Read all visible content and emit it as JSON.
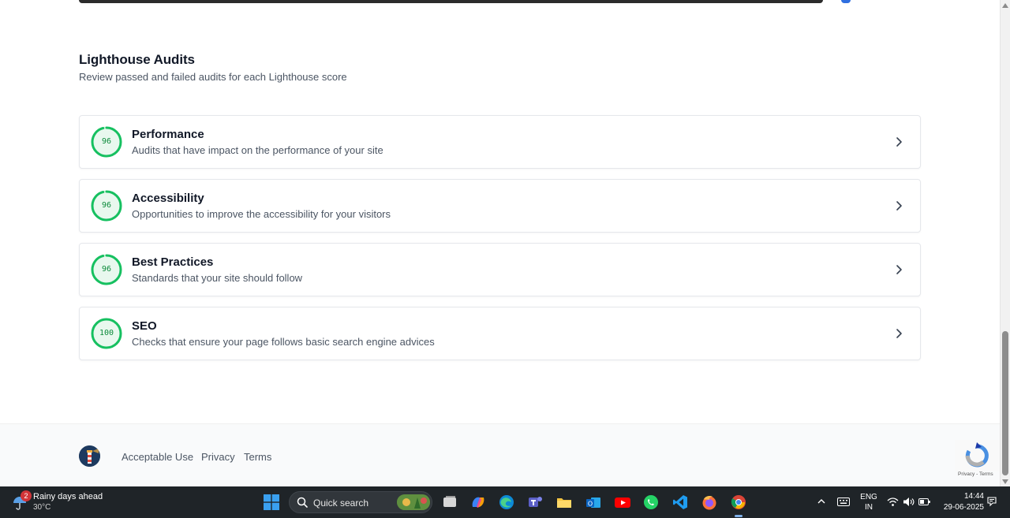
{
  "section": {
    "title": "Lighthouse Audits",
    "subtitle": "Review passed and failed audits for each Lighthouse score"
  },
  "audits": [
    {
      "score": "96",
      "score_value": 96,
      "title": "Performance",
      "description": "Audits that have impact on the performance of your site"
    },
    {
      "score": "96",
      "score_value": 96,
      "title": "Accessibility",
      "description": "Opportunities to improve the accessibility for your visitors"
    },
    {
      "score": "96",
      "score_value": 96,
      "title": "Best Practices",
      "description": "Standards that your site should follow"
    },
    {
      "score": "100",
      "score_value": 100,
      "title": "SEO",
      "description": "Checks that ensure your page follows basic search engine advices"
    }
  ],
  "colors": {
    "score_good": "#16c060",
    "score_text": "#0b8a3a",
    "taskbar_bg": "#1f2428"
  },
  "footer": {
    "links": [
      "Acceptable Use",
      "Privacy",
      "Terms"
    ],
    "recaptcha_text": "Privacy - Terms"
  },
  "taskbar": {
    "weather": {
      "badge": "2",
      "title": "Rainy days ahead",
      "temp": "30°C"
    },
    "search_label": "Quick search",
    "apps": [
      "file-explorer-icon",
      "copilot-icon",
      "edge-icon",
      "teams-icon",
      "folder-icon",
      "outlook-icon",
      "youtube-icon",
      "whatsapp-icon",
      "vscode-icon",
      "firefox-icon",
      "chrome-icon"
    ],
    "language": {
      "line1": "ENG",
      "line2": "IN"
    },
    "clock": {
      "time": "14:44",
      "date": "29-06-2025"
    }
  }
}
